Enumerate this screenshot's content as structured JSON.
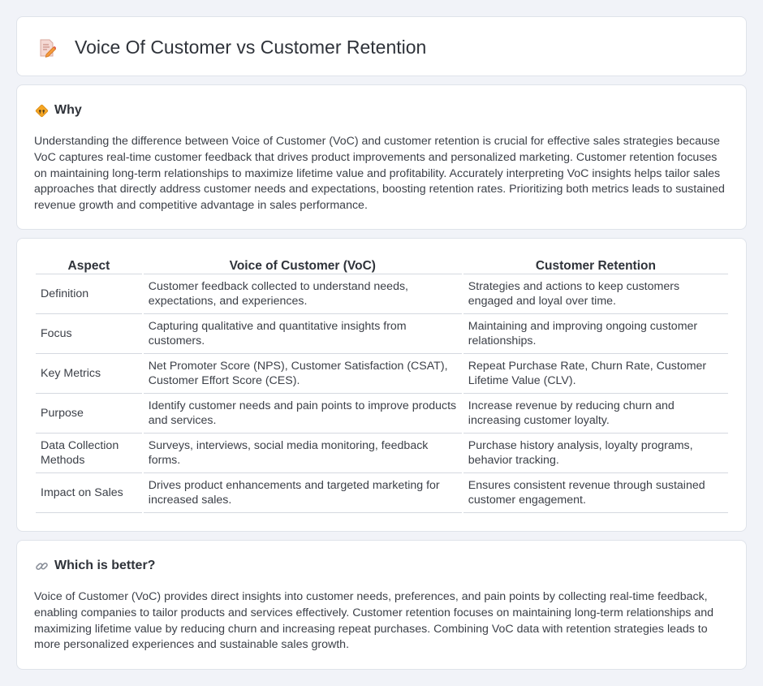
{
  "header": {
    "title": "Voice Of Customer vs Customer Retention"
  },
  "why": {
    "heading": "Why",
    "body": "Understanding the difference between Voice of Customer (VoC) and customer retention is crucial for effective sales strategies because VoC captures real-time customer feedback that drives product improvements and personalized marketing. Customer retention focuses on maintaining long-term relationships to maximize lifetime value and profitability. Accurately interpreting VoC insights helps tailor sales approaches that directly address customer needs and expectations, boosting retention rates. Prioritizing both metrics leads to sustained revenue growth and competitive advantage in sales performance."
  },
  "comparison": {
    "headers": [
      "Aspect",
      "Voice of Customer (VoC)",
      "Customer Retention"
    ],
    "rows": [
      [
        "Definition",
        "Customer feedback collected to understand needs, expectations, and experiences.",
        "Strategies and actions to keep customers engaged and loyal over time."
      ],
      [
        "Focus",
        "Capturing qualitative and quantitative insights from customers.",
        "Maintaining and improving ongoing customer relationships."
      ],
      [
        "Key Metrics",
        "Net Promoter Score (NPS), Customer Satisfaction (CSAT), Customer Effort Score (CES).",
        "Repeat Purchase Rate, Churn Rate, Customer Lifetime Value (CLV)."
      ],
      [
        "Purpose",
        "Identify customer needs and pain points to improve products and services.",
        "Increase revenue by reducing churn and increasing customer loyalty."
      ],
      [
        "Data Collection Methods",
        "Surveys, interviews, social media monitoring, feedback forms.",
        "Purchase history analysis, loyalty programs, behavior tracking."
      ],
      [
        "Impact on Sales",
        "Drives product enhancements and targeted marketing for increased sales.",
        "Ensures consistent revenue through sustained customer engagement."
      ]
    ]
  },
  "better": {
    "heading": "Which is better?",
    "body": "Voice of Customer (VoC) provides direct insights into customer needs, preferences, and pain points by collecting real-time feedback, enabling companies to tailor products and services effectively. Customer retention focuses on maintaining long-term relationships and maximizing lifetime value by reducing churn and increasing repeat purchases. Combining VoC data with retention strategies leads to more personalized experiences and sustainable sales growth."
  },
  "icons": {
    "title": "document-edit-icon",
    "why": "diamond-sign-icon",
    "better": "link-icon"
  },
  "colors": {
    "background": "#f1f3f8",
    "card": "#ffffff",
    "accent_orange": "#f5a623"
  }
}
